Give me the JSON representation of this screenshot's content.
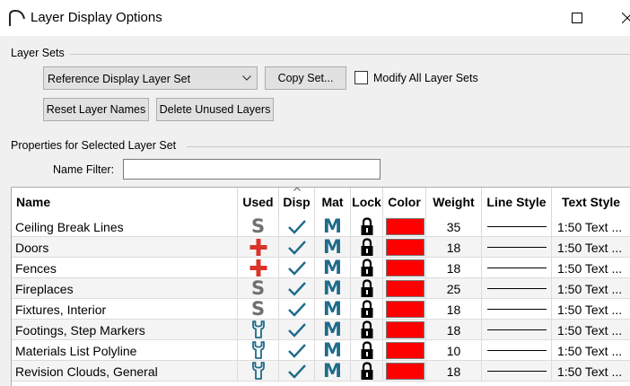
{
  "window": {
    "title": "Layer Display Options"
  },
  "layer_sets": {
    "group_label": "Layer Sets",
    "selected_set": "Reference Display Layer Set",
    "copy_set_label": "Copy Set...",
    "modify_all_label": "Modify All Layer Sets",
    "modify_all_checked": false,
    "reset_names_label": "Reset Layer Names",
    "delete_unused_label": "Delete Unused Layers"
  },
  "properties": {
    "group_label": "Properties for Selected Layer Set",
    "name_filter_label": "Name Filter:",
    "name_filter_value": ""
  },
  "table": {
    "columns": [
      "Name",
      "Used",
      "Disp",
      "Mat",
      "Lock",
      "Color",
      "Weight",
      "Line Style",
      "Text Style"
    ],
    "rows": [
      {
        "name": "Ceiling Break Lines",
        "used": "s",
        "weight": "35",
        "text_style": "1:50 Text ..."
      },
      {
        "name": "Doors",
        "used": "plus",
        "weight": "18",
        "text_style": "1:50 Text ..."
      },
      {
        "name": "Fences",
        "used": "plus",
        "weight": "18",
        "text_style": "1:50 Text ..."
      },
      {
        "name": "Fireplaces",
        "used": "s",
        "weight": "25",
        "text_style": "1:50 Text ..."
      },
      {
        "name": "Fixtures, Interior",
        "used": "s",
        "weight": "18",
        "text_style": "1:50 Text ..."
      },
      {
        "name": "Footings, Step Markers",
        "used": "wrench",
        "weight": "18",
        "text_style": "1:50 Text ..."
      },
      {
        "name": "Materials List Polyline",
        "used": "wrench",
        "weight": "10",
        "text_style": "1:50 Text ..."
      },
      {
        "name": "Revision Clouds, General",
        "used": "wrench",
        "weight": "18",
        "text_style": "1:50 Text ..."
      }
    ],
    "mat_glyph": "M",
    "s_glyph": "S",
    "layer_color": "#ff0000"
  }
}
